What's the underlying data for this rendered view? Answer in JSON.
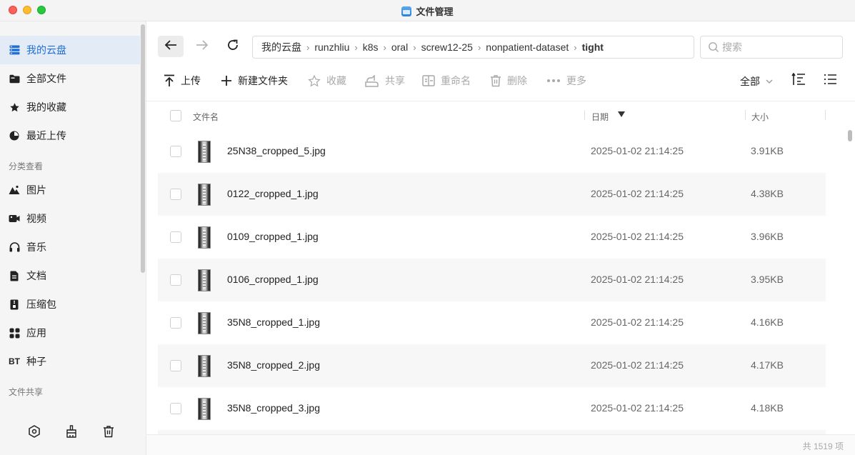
{
  "window": {
    "title": "文件管理"
  },
  "sidebar": {
    "items": [
      {
        "label": "我的云盘",
        "icon": "cloud-drive-icon",
        "active": true
      },
      {
        "label": "全部文件",
        "icon": "folder-icon"
      },
      {
        "label": "我的收藏",
        "icon": "star-icon"
      },
      {
        "label": "最近上传",
        "icon": "clock-pie-icon"
      }
    ],
    "section_category": "分类查看",
    "categories": [
      {
        "label": "图片",
        "icon": "image-icon"
      },
      {
        "label": "视频",
        "icon": "video-icon"
      },
      {
        "label": "音乐",
        "icon": "headphones-icon"
      },
      {
        "label": "文档",
        "icon": "document-icon"
      },
      {
        "label": "压缩包",
        "icon": "archive-icon"
      },
      {
        "label": "应用",
        "icon": "apps-grid-icon"
      },
      {
        "label": "种子",
        "icon": "bt-icon",
        "icon_text": "BT"
      }
    ],
    "section_share": "文件共享",
    "bottom_icons": [
      "settings-hex-icon",
      "cleanup-broom-icon",
      "trash-icon"
    ]
  },
  "nav": {
    "breadcrumb": [
      "我的云盘",
      "runzhliu",
      "k8s",
      "oral",
      "screw12-25",
      "nonpatient-dataset",
      "tight"
    ],
    "search_placeholder": "搜索"
  },
  "toolbar": {
    "upload": "上传",
    "new_folder": "新建文件夹",
    "favorite": "收藏",
    "share": "共享",
    "rename": "重命名",
    "delete": "删除",
    "more": "更多",
    "filter": "全部"
  },
  "table": {
    "headers": {
      "name": "文件名",
      "date": "日期",
      "size": "大小"
    },
    "rows": [
      {
        "name": "25N38_cropped_5.jpg",
        "date": "2025-01-02 21:14:25",
        "size": "3.91KB"
      },
      {
        "name": "0122_cropped_1.jpg",
        "date": "2025-01-02 21:14:25",
        "size": "4.38KB"
      },
      {
        "name": "0109_cropped_1.jpg",
        "date": "2025-01-02 21:14:25",
        "size": "3.96KB"
      },
      {
        "name": "0106_cropped_1.jpg",
        "date": "2025-01-02 21:14:25",
        "size": "3.95KB"
      },
      {
        "name": "35N8_cropped_1.jpg",
        "date": "2025-01-02 21:14:25",
        "size": "4.16KB"
      },
      {
        "name": "35N8_cropped_2.jpg",
        "date": "2025-01-02 21:14:25",
        "size": "4.17KB"
      },
      {
        "name": "35N8_cropped_3.jpg",
        "date": "2025-01-02 21:14:25",
        "size": "4.18KB"
      }
    ]
  },
  "footer": {
    "count": "共 1519 项"
  },
  "colors": {
    "accent": "#1f6fd6",
    "active_bg": "#e3ebf7"
  }
}
